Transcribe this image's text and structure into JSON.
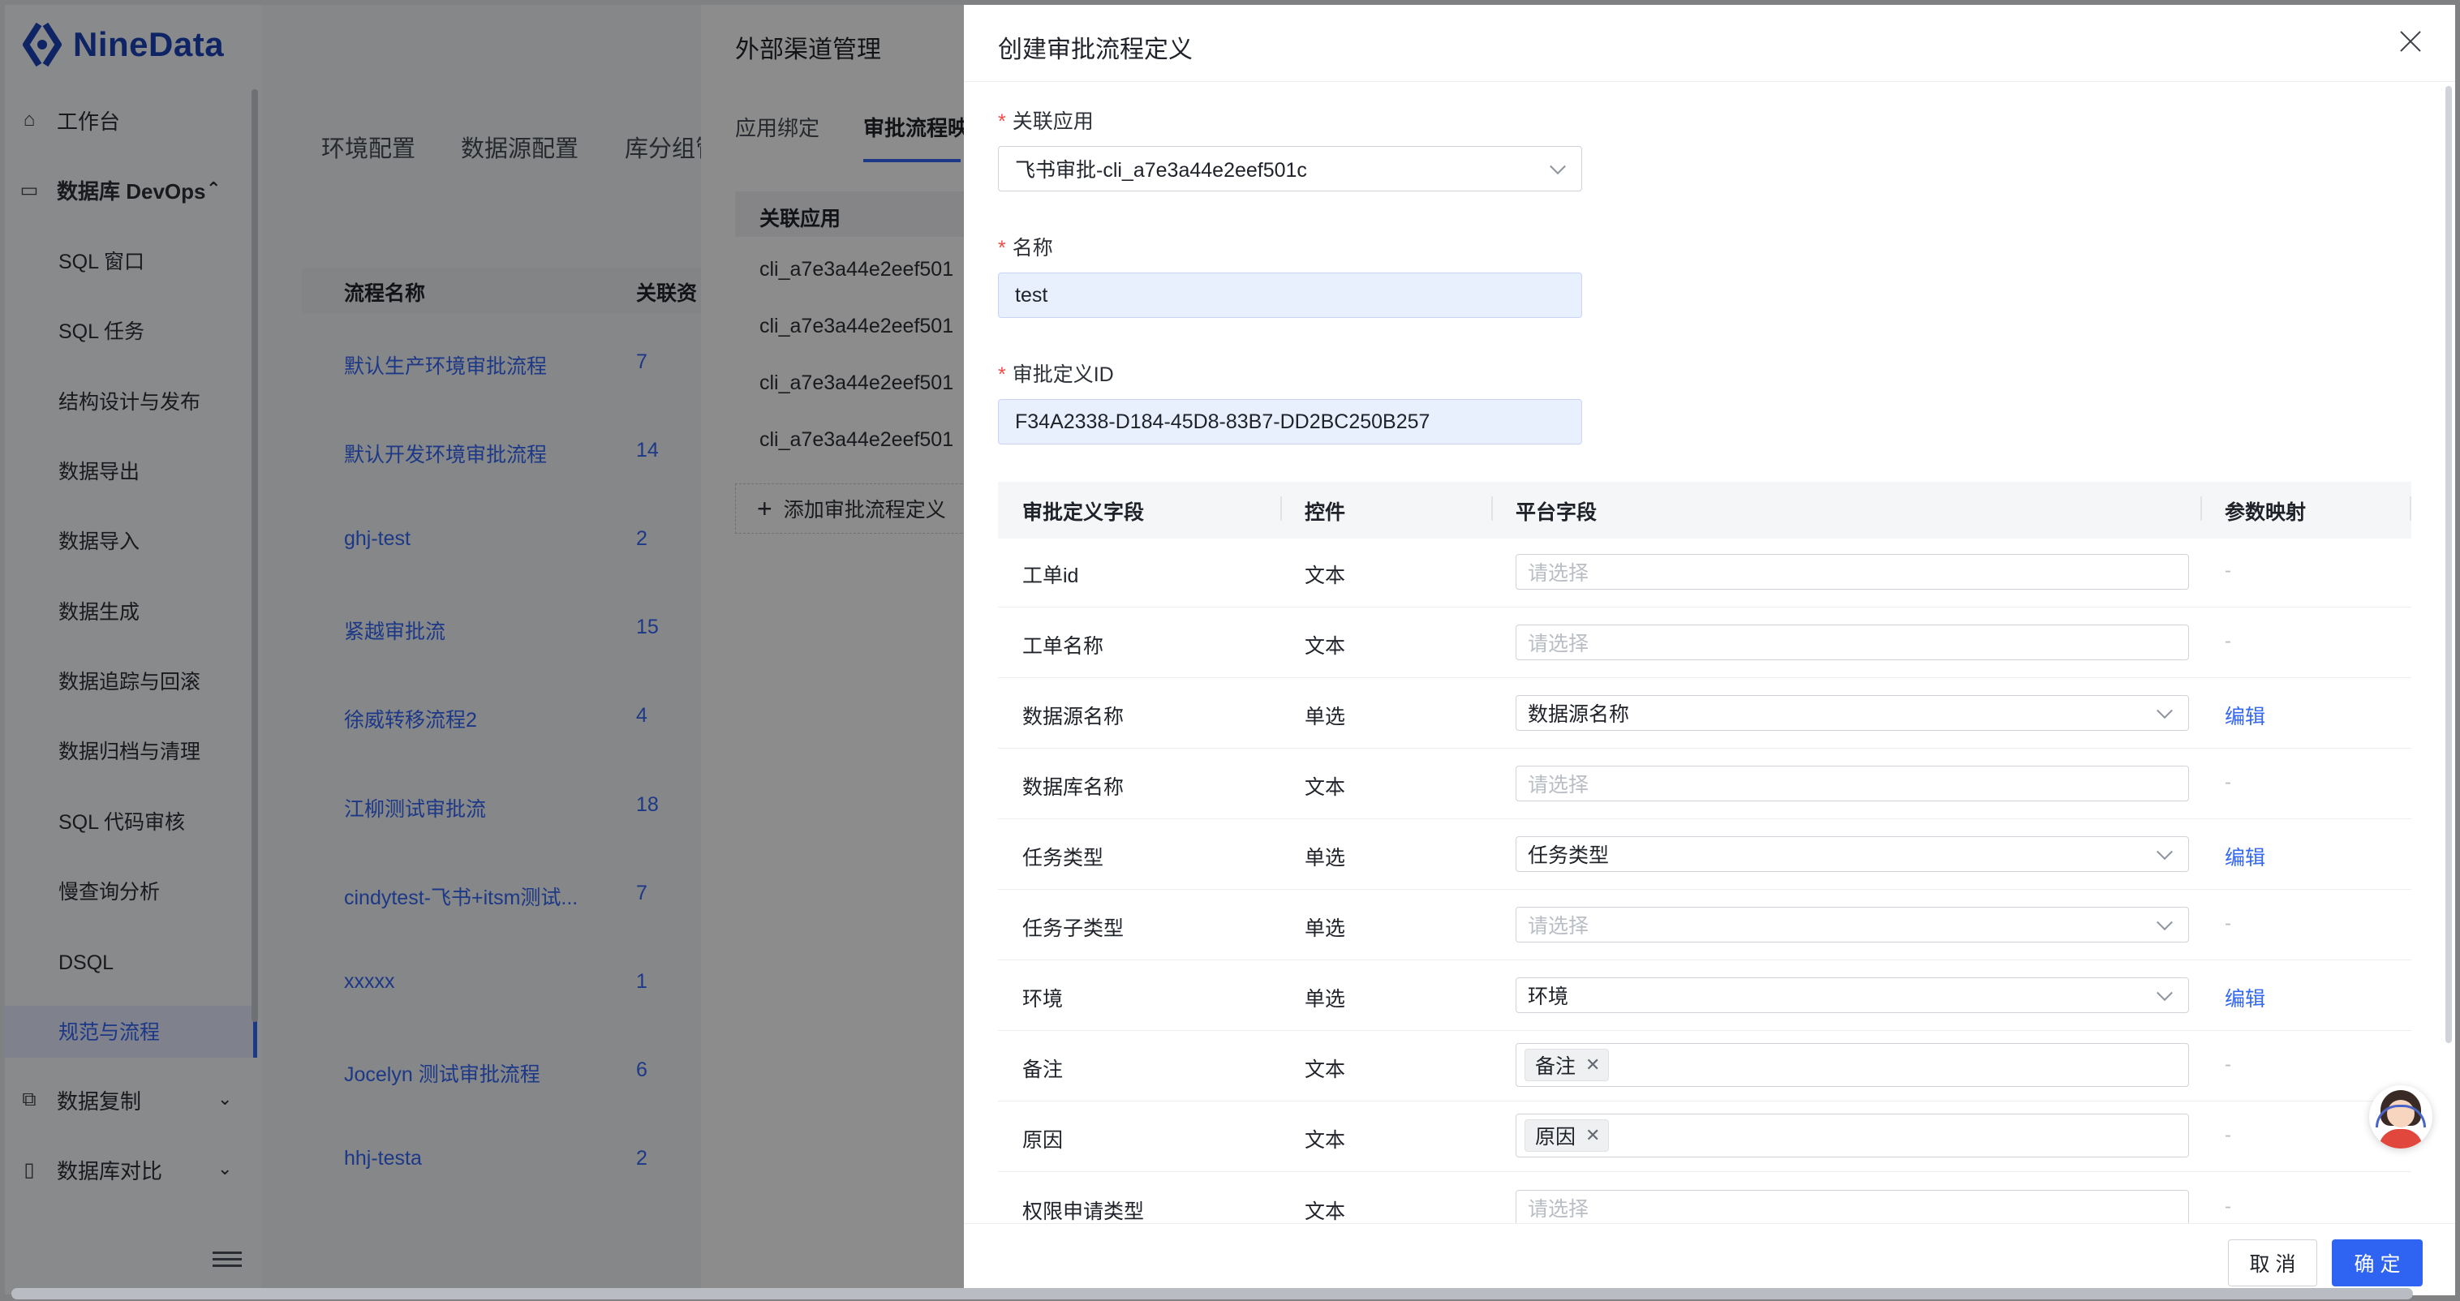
{
  "brand": {
    "logo_text": "NineData",
    "accent": "#1d43b8"
  },
  "sidebar": {
    "workbench": "工作台",
    "devops_group": "数据库 DevOps",
    "items": [
      "SQL 窗口",
      "SQL 任务",
      "结构设计与发布",
      "数据导出",
      "数据导入",
      "数据生成",
      "数据追踪与回滚",
      "数据归档与清理",
      "SQL 代码审核",
      "慢查询分析",
      "DSQL",
      "规范与流程"
    ],
    "active_item": "规范与流程",
    "replication": "数据复制",
    "compare": "数据库对比"
  },
  "main": {
    "tabs": [
      "环境配置",
      "数据源配置",
      "库分组管"
    ],
    "table": {
      "headers": [
        "流程名称",
        "关联资"
      ],
      "rows": [
        {
          "name": "默认生产环境审批流程",
          "count": "7"
        },
        {
          "name": "默认开发环境审批流程",
          "count": "14"
        },
        {
          "name": "ghj-test",
          "count": "2"
        },
        {
          "name": "紧越审批流",
          "count": "15"
        },
        {
          "name": "徐威转移流程2",
          "count": "4"
        },
        {
          "name": "江柳测试审批流",
          "count": "18"
        },
        {
          "name": "cindytest-飞书+itsm测试...",
          "count": "7"
        },
        {
          "name": "xxxxx",
          "count": "1"
        },
        {
          "name": "Jocelyn 测试审批流程",
          "count": "6"
        },
        {
          "name": "hhj-testa",
          "count": "2"
        }
      ]
    }
  },
  "middle_drawer": {
    "title": "外部渠道管理",
    "tabs": [
      "应用绑定",
      "审批流程映"
    ],
    "active_tab": "审批流程映",
    "table_header": "关联应用",
    "rows": [
      "cli_a7e3a44e2eef501",
      "cli_a7e3a44e2eef501",
      "cli_a7e3a44e2eef501",
      "cli_a7e3a44e2eef501"
    ],
    "add_button": "添加审批流程定义"
  },
  "drawer": {
    "title": "创建审批流程定义",
    "fields": {
      "app_label": "关联应用",
      "app_value": "飞书审批-cli_a7e3a44e2eef501c",
      "name_label": "名称",
      "name_value": "test",
      "def_id_label": "审批定义ID",
      "def_id_value": "F34A2338-D184-45D8-83B7-DD2BC250B257"
    },
    "table": {
      "headers": [
        "审批定义字段",
        "控件",
        "平台字段",
        "参数映射"
      ],
      "placeholder": "请选择",
      "edit_label": "编辑",
      "dash": "-",
      "rows": [
        {
          "field": "工单id",
          "control": "文本",
          "platform": "",
          "mapping": "-"
        },
        {
          "field": "工单名称",
          "control": "文本",
          "platform": "",
          "mapping": "-"
        },
        {
          "field": "数据源名称",
          "control": "单选",
          "platform": "数据源名称",
          "mapping": "编辑"
        },
        {
          "field": "数据库名称",
          "control": "文本",
          "platform": "",
          "mapping": "-"
        },
        {
          "field": "任务类型",
          "control": "单选",
          "platform": "任务类型",
          "mapping": "编辑"
        },
        {
          "field": "任务子类型",
          "control": "单选",
          "platform": "",
          "mapping": "-"
        },
        {
          "field": "环境",
          "control": "单选",
          "platform": "环境",
          "mapping": "编辑"
        },
        {
          "field": "备注",
          "control": "文本",
          "platform": "备注",
          "mapping": "-"
        },
        {
          "field": "原因",
          "control": "文本",
          "platform": "原因",
          "mapping": "-"
        },
        {
          "field": "权限申请类型",
          "control": "文本",
          "platform": "",
          "mapping": "-"
        }
      ]
    },
    "cancel": "取 消",
    "confirm": "确 定"
  },
  "icons": [
    "home-icon",
    "monitor-icon",
    "chevron-up-icon",
    "copy-icon",
    "compare-icon",
    "chevron-down-icon",
    "collapse-menu-icon",
    "close-icon",
    "plus-icon",
    "support-avatar-icon"
  ]
}
